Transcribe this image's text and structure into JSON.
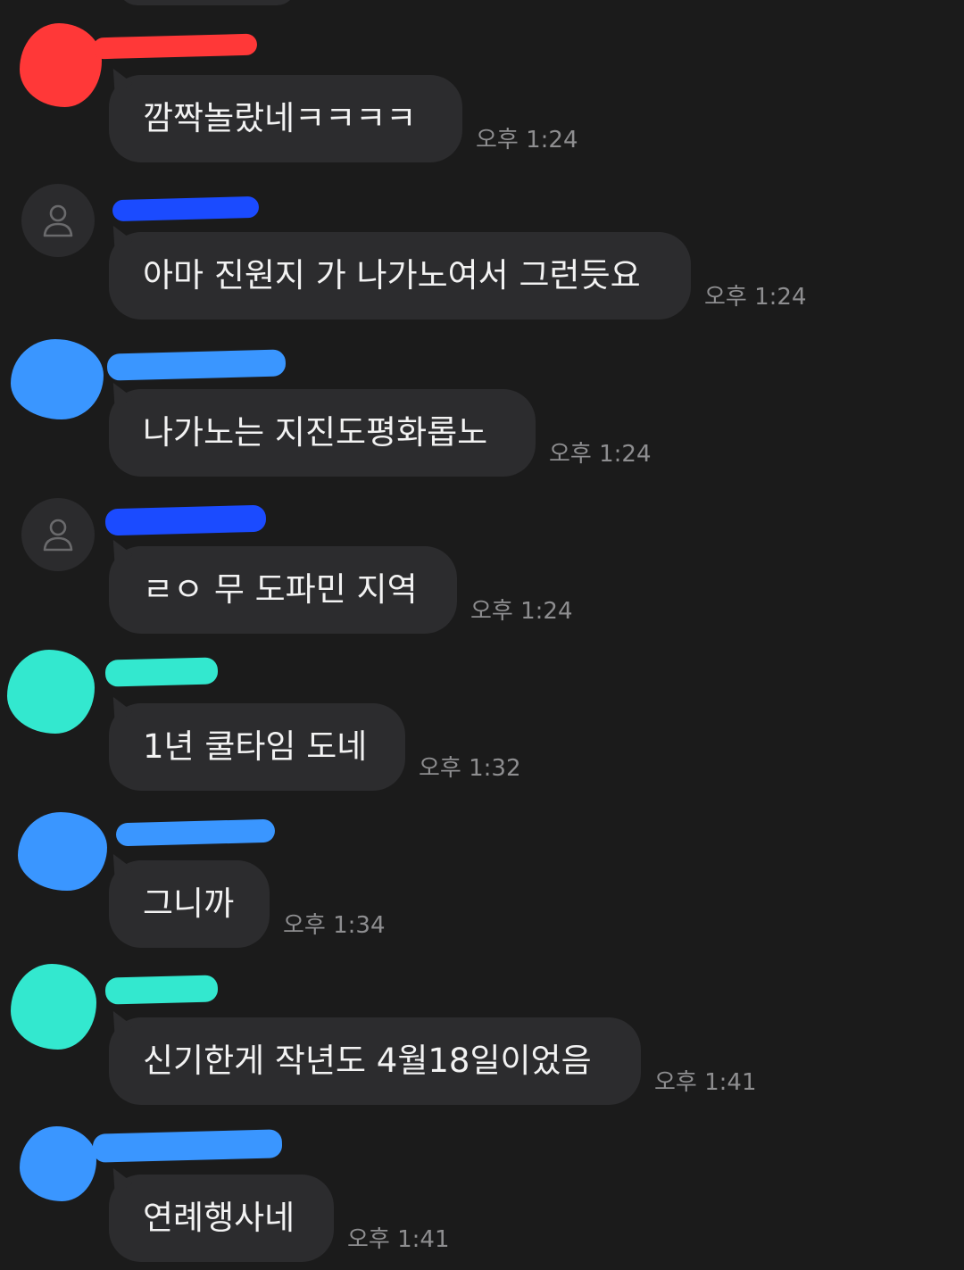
{
  "chat": {
    "messages": [
      {
        "text": "깜짝놀랐네ㅋㅋㅋㅋ",
        "time": "오후 1:24",
        "avatar": "red-scribble",
        "name_redaction_color": "#ff3838"
      },
      {
        "text": "아마 진원지 가 나가노여서 그런듯요",
        "time": "오후 1:24",
        "avatar": "default-person",
        "name_redaction_color": "#1b4bff"
      },
      {
        "text": "나가노는 지진도평화롭노",
        "time": "오후 1:24",
        "avatar": "blue-scribble",
        "name_redaction_color": "#3a96ff"
      },
      {
        "text": "ㄹㅇ 무 도파민 지역",
        "time": "오후 1:24",
        "avatar": "default-person",
        "name_redaction_color": "#1b4bff"
      },
      {
        "text": "1년 쿨타임 도네",
        "time": "오후 1:32",
        "avatar": "teal-scribble",
        "name_redaction_color": "#33e8cf"
      },
      {
        "text": "그니까",
        "time": "오후 1:34",
        "avatar": "blue-scribble",
        "name_redaction_color": "#3a96ff"
      },
      {
        "text": "신기한게 작년도 4월18일이었음",
        "time": "오후 1:41",
        "avatar": "teal-scribble",
        "name_redaction_color": "#33e8cf"
      },
      {
        "text": "연례행사네",
        "time": "오후 1:41",
        "avatar": "blue-scribble",
        "name_redaction_color": "#3a96ff"
      }
    ]
  },
  "colors": {
    "background": "#1b1b1b",
    "bubble": "#2c2c2e",
    "message_text": "#f2f2f2",
    "timestamp": "#8e8e90",
    "default_avatar": "#2b2b2d",
    "redaction_red": "#ff3838",
    "redaction_dark_blue": "#1b4bff",
    "redaction_blue": "#3a96ff",
    "redaction_teal": "#33e8cf"
  }
}
